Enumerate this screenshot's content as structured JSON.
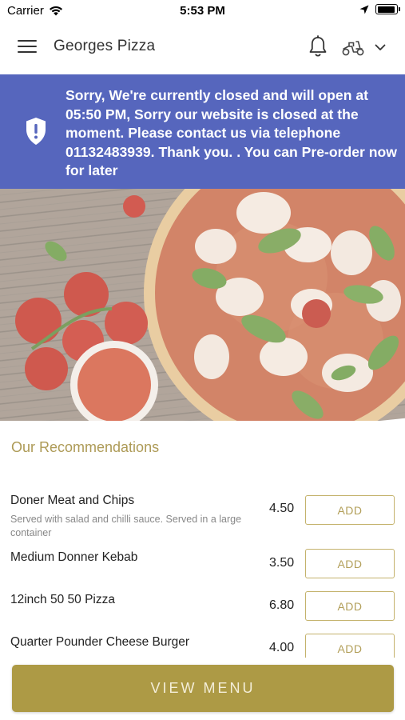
{
  "status_bar": {
    "carrier": "Carrier",
    "time": "5:53 PM",
    "battery_level": 0.95
  },
  "header": {
    "title": "Georges Pizza",
    "menu_icon": "hamburger-icon",
    "bell_icon": "bell-icon",
    "mode_icon": "scooter-icon"
  },
  "banner": {
    "icon": "shield-alert-icon",
    "message": "Sorry, We're currently closed and will open at 05:50 PM, Sorry our website is closed at the moment. Please contact us via telephone 01132483939. Thank you. . You can Pre-order now for later",
    "color": "#5666bd"
  },
  "recommendations": {
    "title": "Our Recommendations",
    "items": [
      {
        "name": "Doner Meat and Chips",
        "description": "Served with salad and chilli sauce. Served in a large container",
        "price": "4.50",
        "button": "ADD"
      },
      {
        "name": "Medium Donner Kebab",
        "description": "",
        "price": "3.50",
        "button": "ADD"
      },
      {
        "name": "12inch 50 50 Pizza",
        "description": "",
        "price": "6.80",
        "button": "ADD"
      },
      {
        "name": "Quarter Pounder Cheese Burger",
        "description": "",
        "price": "4.00",
        "button": "ADD"
      }
    ]
  },
  "cta": {
    "label": "VIEW MENU",
    "color": "#ad9a45"
  },
  "colors": {
    "accent": "#ad9a56",
    "banner": "#5666bd"
  }
}
